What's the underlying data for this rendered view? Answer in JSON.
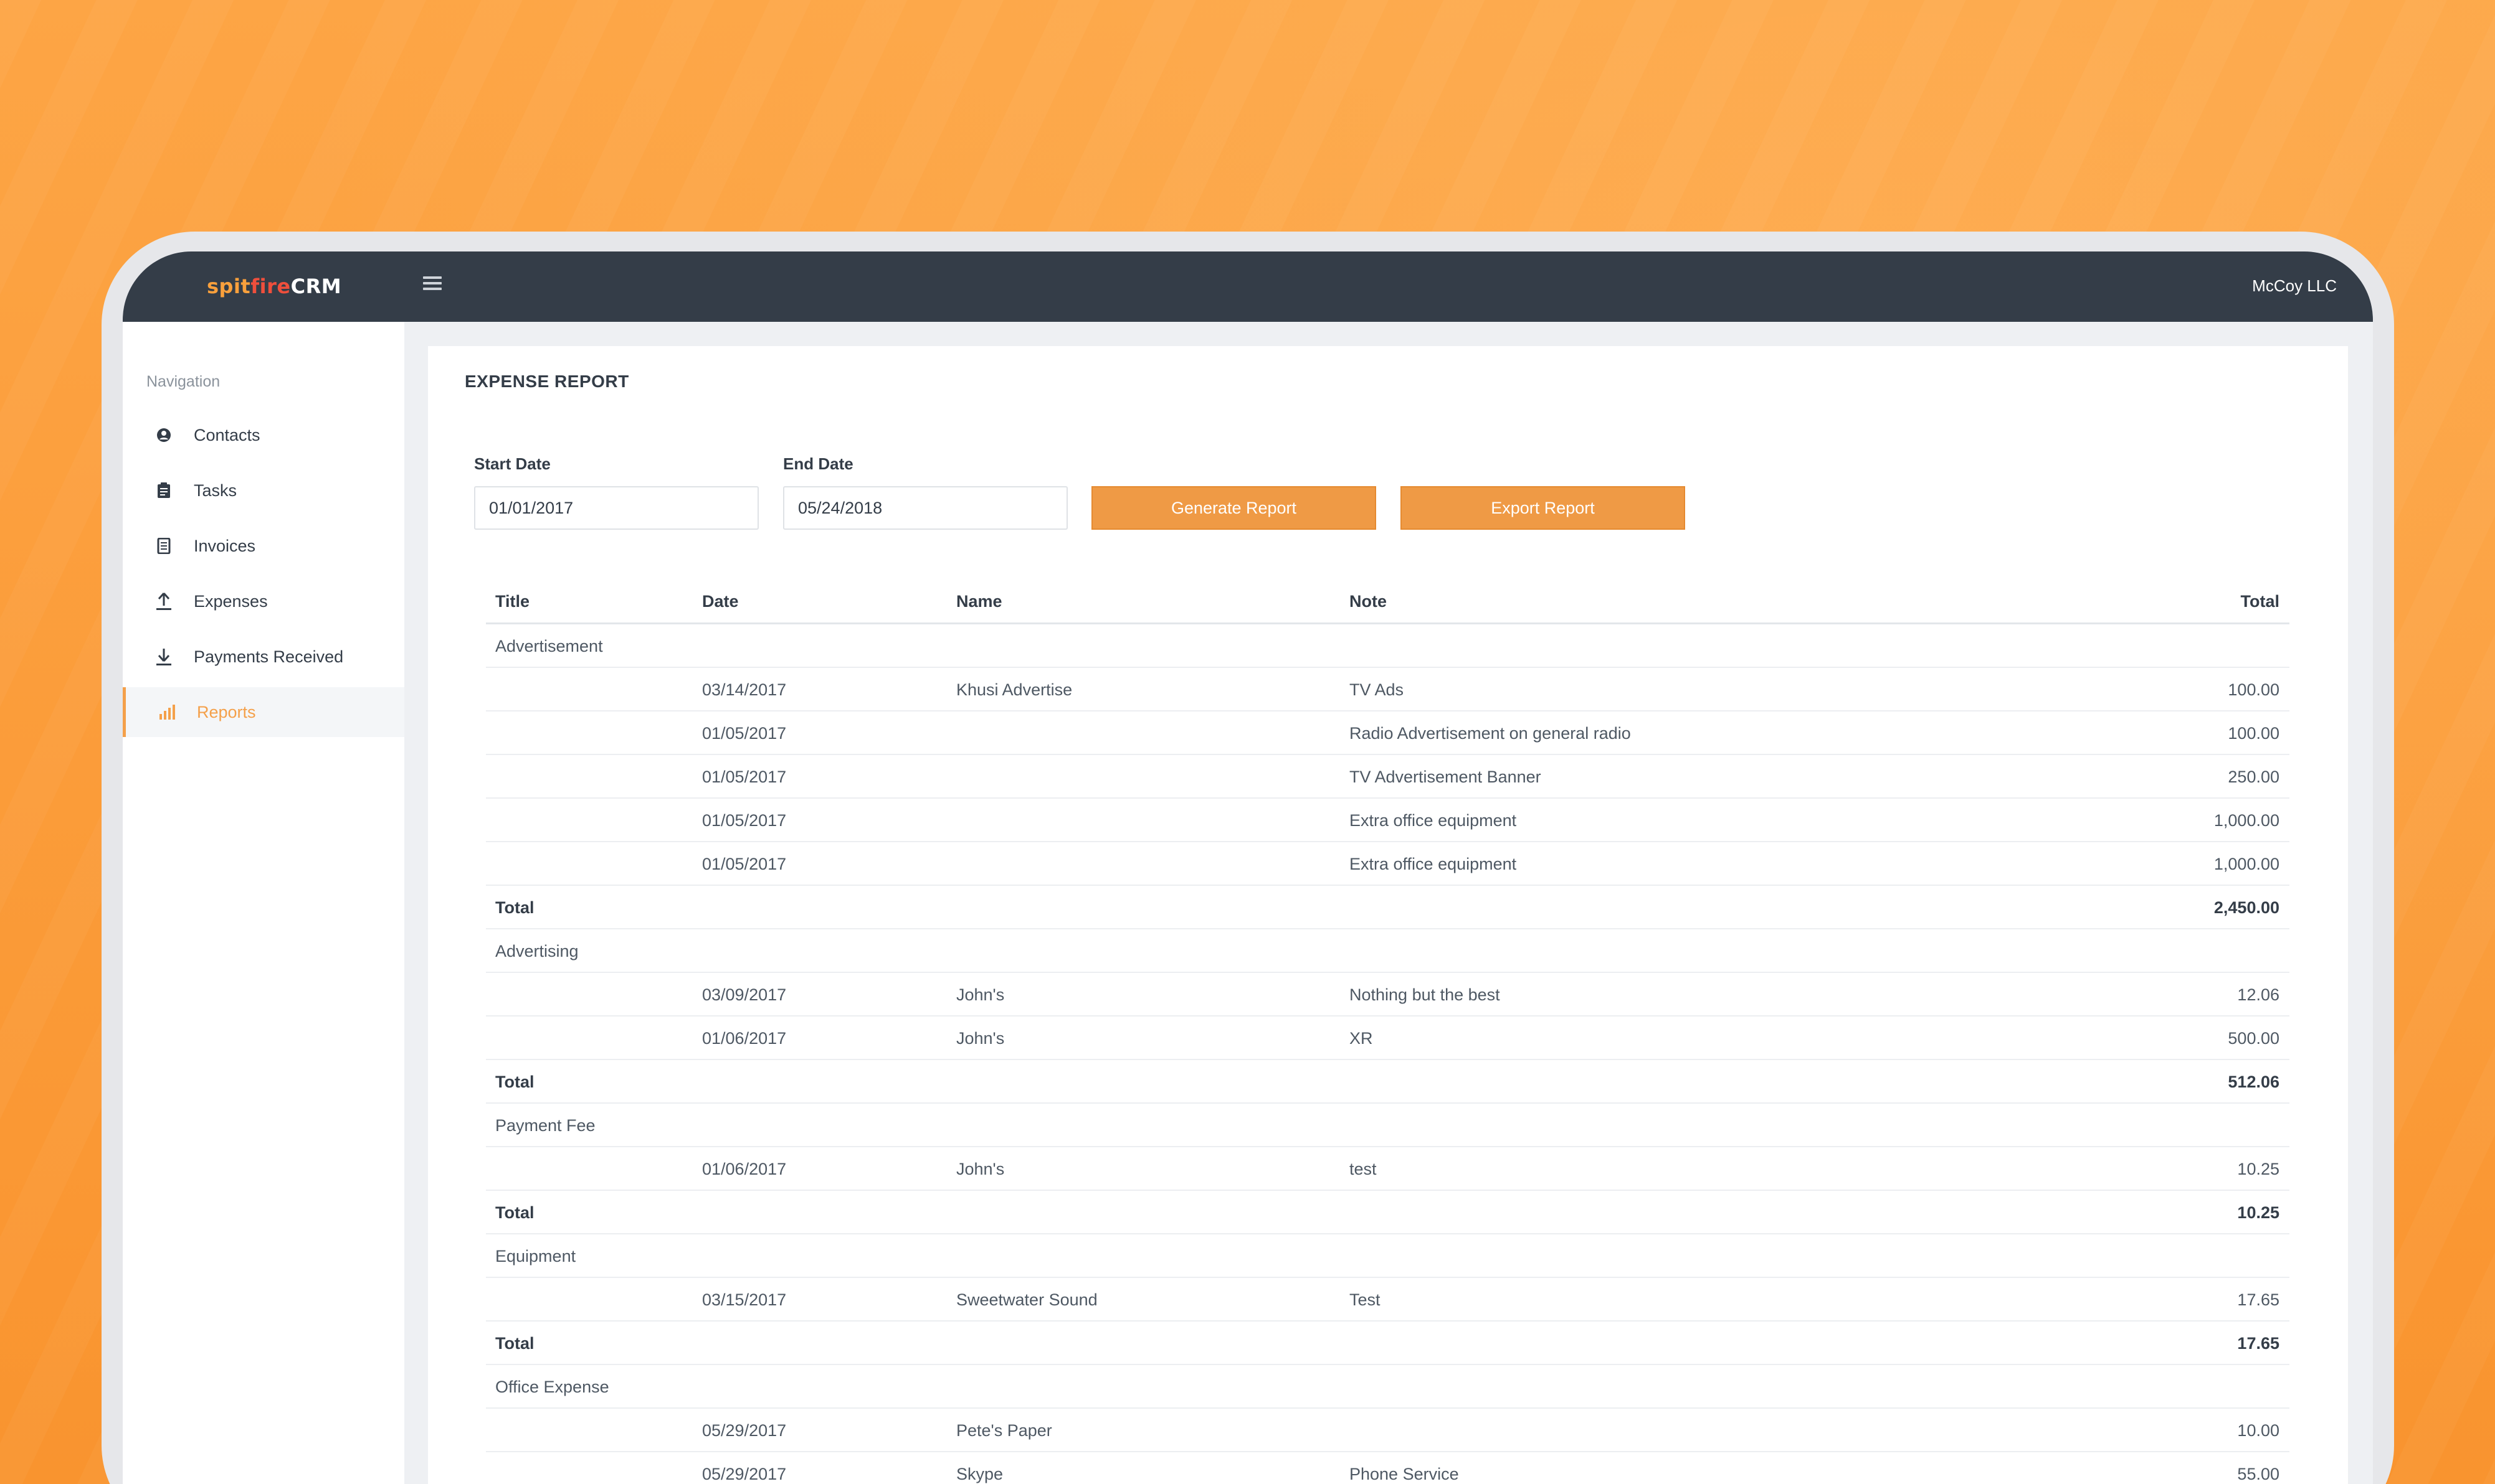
{
  "app": {
    "logo_spit": "spit",
    "logo_fire": "fire",
    "logo_crm": "CRM",
    "company": "McCoy LLC"
  },
  "sidebar": {
    "heading": "Navigation",
    "items": [
      {
        "label": "Contacts",
        "icon": "user-circle-icon"
      },
      {
        "label": "Tasks",
        "icon": "clipboard-icon"
      },
      {
        "label": "Invoices",
        "icon": "document-icon"
      },
      {
        "label": "Expenses",
        "icon": "upload-icon"
      },
      {
        "label": "Payments Received",
        "icon": "download-icon"
      },
      {
        "label": "Reports",
        "icon": "bar-chart-icon",
        "active": true
      }
    ]
  },
  "report": {
    "title": "EXPENSE REPORT",
    "start_label": "Start Date",
    "start_value": "01/01/2017",
    "end_label": "End Date",
    "end_value": "05/24/2018",
    "generate_label": "Generate Report",
    "export_label": "Export Report"
  },
  "table": {
    "headers": {
      "title": "Title",
      "date": "Date",
      "name": "Name",
      "note": "Note",
      "total": "Total"
    },
    "rows": [
      {
        "type": "group",
        "title": "Advertisement"
      },
      {
        "type": "item",
        "date": "03/14/2017",
        "name": "Khusi Advertise",
        "note": "TV Ads",
        "total": "100.00"
      },
      {
        "type": "item",
        "date": "01/05/2017",
        "name": "",
        "note": "Radio Advertisement on general radio",
        "total": "100.00"
      },
      {
        "type": "item",
        "date": "01/05/2017",
        "name": "",
        "note": "TV Advertisement Banner",
        "total": "250.00"
      },
      {
        "type": "item",
        "date": "01/05/2017",
        "name": "",
        "note": "Extra office equipment",
        "total": "1,000.00"
      },
      {
        "type": "item",
        "date": "01/05/2017",
        "name": "",
        "note": "Extra office equipment",
        "total": "1,000.00"
      },
      {
        "type": "sum",
        "title": "Total",
        "total": "2,450.00"
      },
      {
        "type": "group",
        "title": "Advertising"
      },
      {
        "type": "item",
        "date": "03/09/2017",
        "name": "John's",
        "note": "Nothing but the best",
        "total": "12.06"
      },
      {
        "type": "item",
        "date": "01/06/2017",
        "name": "John's",
        "note": "XR",
        "total": "500.00"
      },
      {
        "type": "sum",
        "title": "Total",
        "total": "512.06"
      },
      {
        "type": "group",
        "title": "Payment Fee"
      },
      {
        "type": "item",
        "date": "01/06/2017",
        "name": "John's",
        "note": "test",
        "total": "10.25"
      },
      {
        "type": "sum",
        "title": "Total",
        "total": "10.25"
      },
      {
        "type": "group",
        "title": "Equipment"
      },
      {
        "type": "item",
        "date": "03/15/2017",
        "name": "Sweetwater Sound",
        "note": "Test",
        "total": "17.65"
      },
      {
        "type": "sum",
        "title": "Total",
        "total": "17.65"
      },
      {
        "type": "group",
        "title": "Office Expense"
      },
      {
        "type": "item",
        "date": "05/29/2017",
        "name": "Pete's Paper",
        "note": "",
        "total": "10.00"
      },
      {
        "type": "item",
        "date": "05/29/2017",
        "name": "Skype",
        "note": "Phone Service",
        "total": "55.00"
      }
    ]
  },
  "colors": {
    "background": "#fb9a36",
    "topbar": "#343d48",
    "accent": "#ef9a45"
  }
}
